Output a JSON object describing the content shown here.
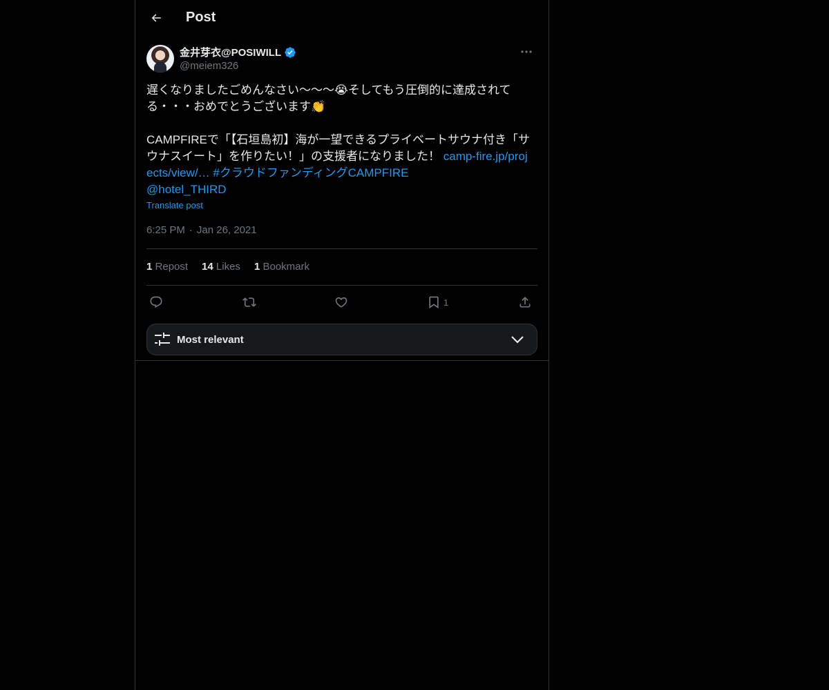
{
  "header": {
    "title": "Post"
  },
  "post": {
    "author": {
      "display_name": "金井芽衣@POSIWILL",
      "handle": "@meiem326",
      "verified": true
    },
    "text_intro": "遅くなりましたごめんなさい〜〜〜😭そしてもう圧倒的に達成されてる・・・おめでとうございます👏\n\nCAMPFIREで「【石垣島初】海が一望できるプライベートサウナ付き「サウナスイート」を作りたい！」の支援者になりました！ ",
    "link_url": "camp-fire.jp/projects/view/…",
    "hashtag": "#クラウドファンディングCAMPFIRE",
    "mention": "@hotel_THIRD",
    "translate_label": "Translate post",
    "time": "6:25 PM",
    "separator": "·",
    "date": "Jan 26, 2021"
  },
  "stats": {
    "reposts_count": "1",
    "reposts_label": "Repost",
    "likes_count": "14",
    "likes_label": "Likes",
    "bookmarks_count": "1",
    "bookmarks_label": "Bookmark"
  },
  "actions": {
    "reply_icon": "reply-icon",
    "repost_icon": "repost-icon",
    "like_icon": "heart-icon",
    "bookmark_icon": "bookmark-icon",
    "bookmark_count": "1",
    "share_icon": "share-icon"
  },
  "replies_sort": {
    "label": "Most relevant"
  },
  "colors": {
    "background": "#000000",
    "text": "#e7e9ea",
    "muted": "#71767b",
    "link": "#1d9bf0",
    "border": "#2f3336"
  }
}
